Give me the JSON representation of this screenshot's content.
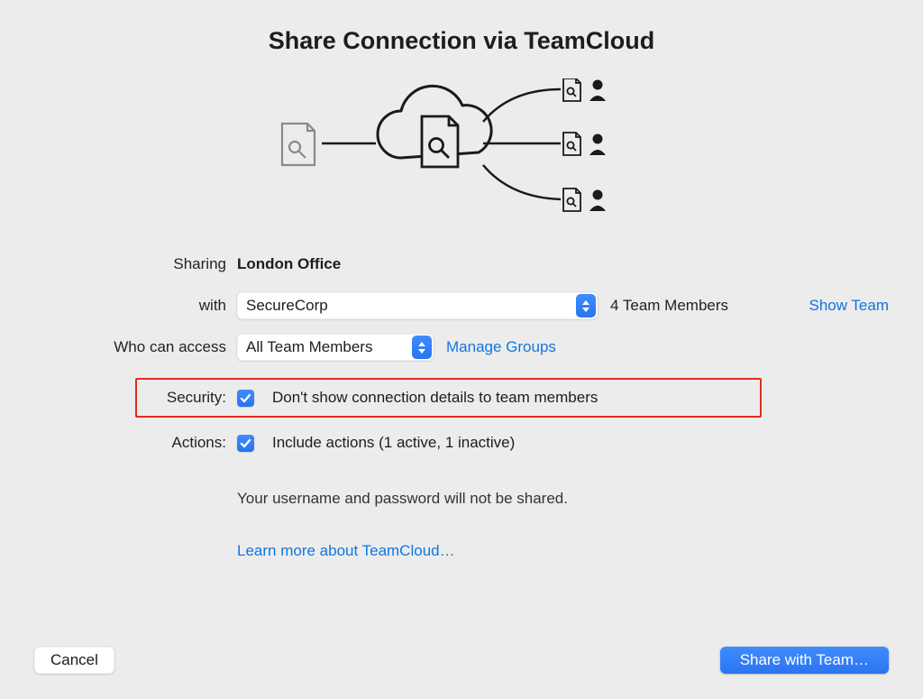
{
  "title": "Share Connection via TeamCloud",
  "labels": {
    "sharing": "Sharing",
    "with": "with",
    "who_can_access": "Who can access",
    "security": "Security:",
    "actions": "Actions:"
  },
  "sharing": {
    "connection_name": "London Office",
    "team_select": "SecureCorp",
    "member_count": "4 Team Members",
    "show_team": "Show Team",
    "access_select": "All Team Members",
    "manage_groups": "Manage Groups"
  },
  "security": {
    "checkbox_label": "Don't show connection details to team members",
    "checked": true
  },
  "actions": {
    "checkbox_label": "Include actions (1 active, 1 inactive)",
    "checked": true
  },
  "note": "Your username and password will not be shared.",
  "learn_more": "Learn more about TeamCloud…",
  "buttons": {
    "cancel": "Cancel",
    "share": "Share with Team…"
  },
  "icons": {
    "cloud": "cloud-icon",
    "key_doc": "key-document-icon",
    "user": "user-icon"
  }
}
